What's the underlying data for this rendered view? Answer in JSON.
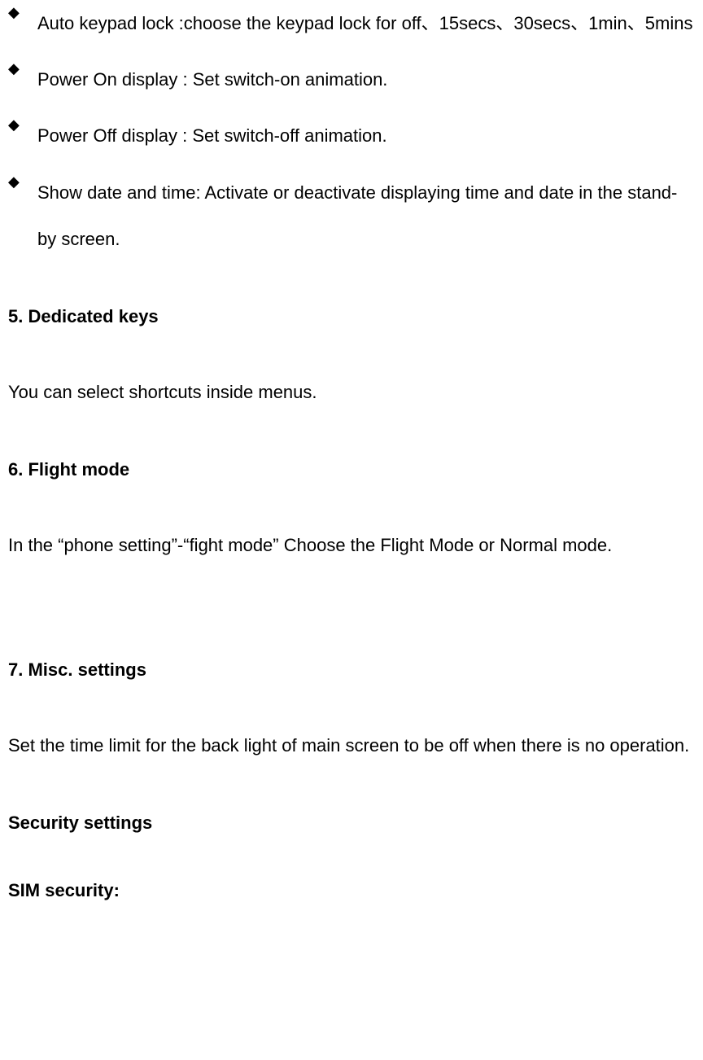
{
  "bullets": [
    "Auto keypad lock :choose the keypad lock for off、15secs、30secs、1min、5mins",
    "Power On display : Set switch-on animation.",
    "Power Off display : Set switch-off animation.",
    "Show date and time: Activate or deactivate displaying time and date in the stand-by screen."
  ],
  "sections": {
    "dedicatedKeys": {
      "heading": "5. Dedicated keys",
      "body": "You can select shortcuts inside menus."
    },
    "flightMode": {
      "heading": "6. Flight mode",
      "body": "In the “phone setting”-“fight mode” Choose the Flight Mode or Normal mode."
    },
    "miscSettings": {
      "heading": "7. Misc. settings",
      "body": "Set the time limit for the back light of main screen to be off when there is no operation."
    },
    "securitySettings": {
      "heading": "Security settings"
    },
    "simSecurity": {
      "heading": "SIM security:"
    }
  },
  "bulletGlyph": "◆"
}
